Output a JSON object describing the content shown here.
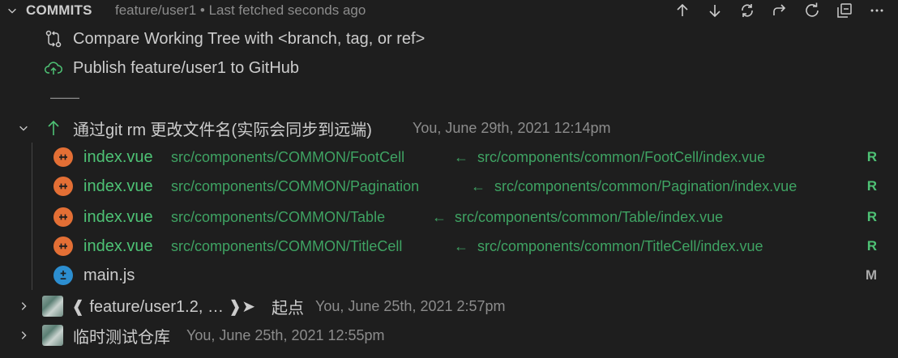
{
  "header": {
    "title": "COMMITS",
    "description": "feature/user1 • Last fetched seconds ago",
    "actions": [
      "arrow-up-icon",
      "arrow-down-icon",
      "sync-icon",
      "redo-icon",
      "refresh-icon",
      "collapse-all-icon",
      "more-icon"
    ]
  },
  "compare": {
    "label": "Compare Working Tree with <branch, tag, or ref>"
  },
  "publish": {
    "label": "Publish feature/user1 to GitHub"
  },
  "divider": "——",
  "commit_main": {
    "message": "通过git rm 更改文件名(实际会同步到远端)",
    "meta": "You, June 29th, 2021 12:14pm"
  },
  "files": [
    {
      "name": "index.vue",
      "path": "src/components/COMMON/FootCell",
      "arrow": "←",
      "orig": "src/components/common/FootCell/index.vue",
      "status": "R",
      "type": "vue"
    },
    {
      "name": "index.vue",
      "path": "src/components/COMMON/Pagination",
      "arrow": "←",
      "orig": "src/components/common/Pagination/index.vue",
      "status": "R",
      "type": "vue"
    },
    {
      "name": "index.vue",
      "path": "src/components/COMMON/Table",
      "arrow": "←",
      "orig": "src/components/common/Table/index.vue",
      "status": "R",
      "type": "vue"
    },
    {
      "name": "index.vue",
      "path": "src/components/COMMON/TitleCell",
      "arrow": "←",
      "orig": "src/components/common/TitleCell/index.vue",
      "status": "R",
      "type": "vue"
    },
    {
      "name": "main.js",
      "path": "",
      "arrow": "",
      "orig": "",
      "status": "M",
      "type": "js"
    }
  ],
  "commit_2": {
    "refs": "❰ feature/user1.2, … ❱➤",
    "message": "起点",
    "meta": "You, June 25th, 2021 2:57pm"
  },
  "commit_3": {
    "message": "临时测试仓库",
    "meta": "You, June 25th, 2021 12:55pm"
  },
  "colors": {
    "background": "#1e1e1e",
    "green": "#4ec275",
    "vue": "#e36f35",
    "js": "#2c8ed0"
  }
}
